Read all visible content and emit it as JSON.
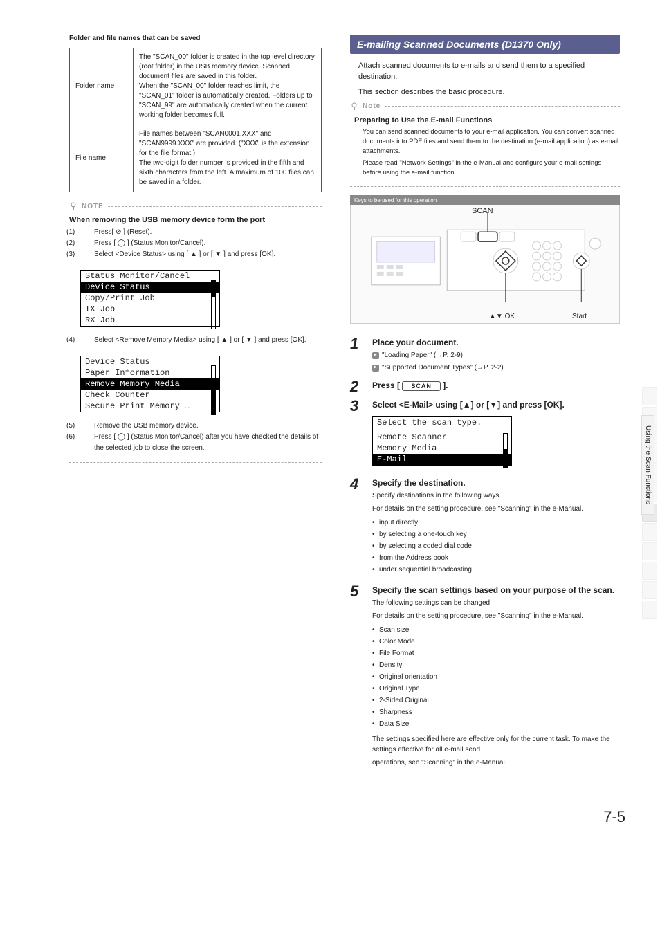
{
  "left": {
    "tableHeading": "Folder and file names that can be saved",
    "rows": [
      {
        "label": "Folder name",
        "desc": "The \"SCAN_00\" folder is created in the top level directory (root folder) in the USB memory device. Scanned document files are saved in this folder.\nWhen the \"SCAN_00\" folder reaches limit, the \"SCAN_01\" folder is automatically created. Folders up to \"SCAN_99\" are automatically created when the current working folder becomes full."
      },
      {
        "label": "File name",
        "desc": "File names between \"SCAN0001.XXX\" and \"SCAN9999.XXX\" are provided. (\"XXX\" is the extension for the file format.)\nThe two-digit folder number is provided in the fifth and sixth characters from the left. A maximum of 100 files can be saved in a folder."
      }
    ],
    "noteLabel": "NOTE",
    "removeHeading": "When removing the USB memory device form the port",
    "removeSteps": [
      {
        "n": "(1)",
        "text": "Press[ ⊘ ] (Reset)."
      },
      {
        "n": "(2)",
        "text": "Press [ ◯ ] (Status Monitor/Cancel)."
      },
      {
        "n": "(3)",
        "text": "Select <Device Status> using [ ▲ ] or [ ▼ ] and press [OK]."
      }
    ],
    "lcd1": {
      "title": "Status Monitor/Cancel",
      "items": [
        "Device Status",
        "Copy/Print Job",
        "TX Job",
        "RX Job"
      ],
      "sel": 0
    },
    "removeSteps2": [
      {
        "n": "(4)",
        "text": "Select <Remove Memory Media> using [ ▲ ] or [ ▼ ] and press [OK]."
      }
    ],
    "lcd2": {
      "title": "Device Status",
      "items": [
        "Paper Information",
        "Remove Memory Media",
        "Check Counter",
        "Secure Print Memory …"
      ],
      "sel": 1
    },
    "removeSteps3": [
      {
        "n": "(5)",
        "text": "Remove the USB memory device."
      },
      {
        "n": "(6)",
        "text": "Press [ ◯ ] (Status Monitor/Cancel) after you have checked the details of the selected job to close the screen."
      }
    ]
  },
  "right": {
    "ribbon": "E-mailing Scanned Documents (D1370 Only)",
    "intro1": "Attach scanned documents to e-mails and send them to a specified destination.",
    "intro2": "This section describes the basic procedure.",
    "noteLabel": "Note",
    "noteHeading": "Preparing to Use the E-mail Functions",
    "noteBody1": "You can send scanned documents to your e-mail application. You can convert scanned documents into PDF files and send them to the destination (e-mail application) as e-mail attachments.",
    "noteBody2": "Please read \"Network Settings\" in the e-Manual and configure your e-mail settings before using the e-mail function.",
    "keysBar": "Keys to be used for this operation",
    "panel": {
      "scan": "SCAN",
      "ok": "▲▼ OK",
      "start": "Start"
    },
    "step1": {
      "title": "Place your document.",
      "refs": [
        "\"Loading Paper\" (→P. 2-9)",
        "\"Supported Document Types\" (→P. 2-2)"
      ]
    },
    "step2": {
      "titlePre": "Press [",
      "btn": "SCAN",
      "titlePost": "]."
    },
    "step3": {
      "title": "Select <E-Mail> using [▲] or [▼] and press [OK].",
      "lcd": {
        "title": "Select the scan type.",
        "items": [
          "Remote Scanner",
          "Memory Media",
          "E-Mail"
        ],
        "sel": 2
      }
    },
    "step4": {
      "title": "Specify the destination.",
      "p1": "Specify destinations in the following ways.",
      "p2": "For details on the setting procedure, see \"Scanning\" in the e-Manual.",
      "bullets": [
        "input directly",
        "by selecting a one-touch key",
        "by selecting a coded dial code",
        "from the Address book",
        "under sequential broadcasting"
      ]
    },
    "step5": {
      "title": "Specify the scan settings based on your purpose of the scan.",
      "p1": "The following settings can be changed.",
      "p2": "For details on the setting procedure, see \"Scanning\" in the e-Manual.",
      "bullets": [
        "Scan size",
        "Color Mode",
        "File Format",
        "Density",
        "Original orientation",
        "Original Type",
        "2-Sided Original",
        "Sharpness",
        "Data Size"
      ],
      "p3": "The settings specified here are effective only for the current task. To make the settings effective for all e-mail send",
      "p4": "operations, see \"Scanning\" in the e-Manual."
    }
  },
  "sideTab": "Using the Scan Functions",
  "pageNum": "7-5"
}
